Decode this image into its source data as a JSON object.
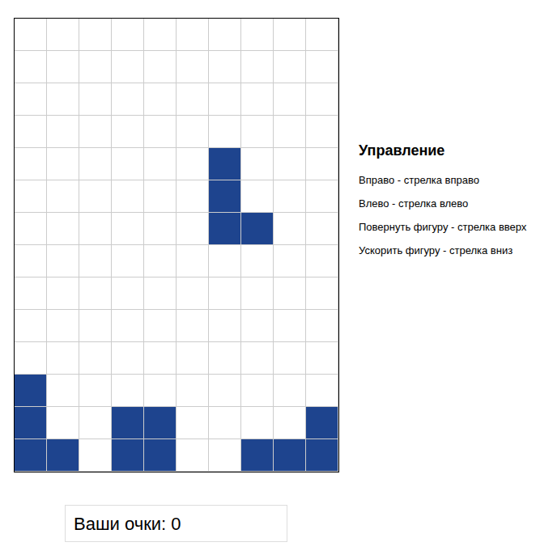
{
  "board": {
    "rows": [
      [
        false,
        false,
        false,
        false,
        false,
        false,
        false,
        false,
        false,
        false
      ],
      [
        false,
        false,
        false,
        false,
        false,
        false,
        false,
        false,
        false,
        false
      ],
      [
        false,
        false,
        false,
        false,
        false,
        false,
        false,
        false,
        false,
        false
      ],
      [
        false,
        false,
        false,
        false,
        false,
        false,
        false,
        false,
        false,
        false
      ],
      [
        false,
        false,
        false,
        false,
        false,
        false,
        true,
        false,
        false,
        false
      ],
      [
        false,
        false,
        false,
        false,
        false,
        false,
        true,
        false,
        false,
        false
      ],
      [
        false,
        false,
        false,
        false,
        false,
        false,
        true,
        true,
        false,
        false
      ],
      [
        false,
        false,
        false,
        false,
        false,
        false,
        false,
        false,
        false,
        false
      ],
      [
        false,
        false,
        false,
        false,
        false,
        false,
        false,
        false,
        false,
        false
      ],
      [
        false,
        false,
        false,
        false,
        false,
        false,
        false,
        false,
        false,
        false
      ],
      [
        false,
        false,
        false,
        false,
        false,
        false,
        false,
        false,
        false,
        false
      ],
      [
        true,
        false,
        false,
        false,
        false,
        false,
        false,
        false,
        false,
        false
      ],
      [
        true,
        false,
        false,
        true,
        true,
        false,
        false,
        false,
        false,
        true
      ],
      [
        true,
        true,
        false,
        true,
        true,
        false,
        false,
        true,
        true,
        true
      ]
    ]
  },
  "controls": {
    "title": "Управление",
    "items": [
      "Вправо - стрелка вправо",
      "Влево - стрелка влево",
      "Повернуть фигуру - стрелка вверх",
      "Ускорить фигуру - стрелка вниз"
    ]
  },
  "score": {
    "label": "Ваши очки:",
    "value": "0"
  }
}
